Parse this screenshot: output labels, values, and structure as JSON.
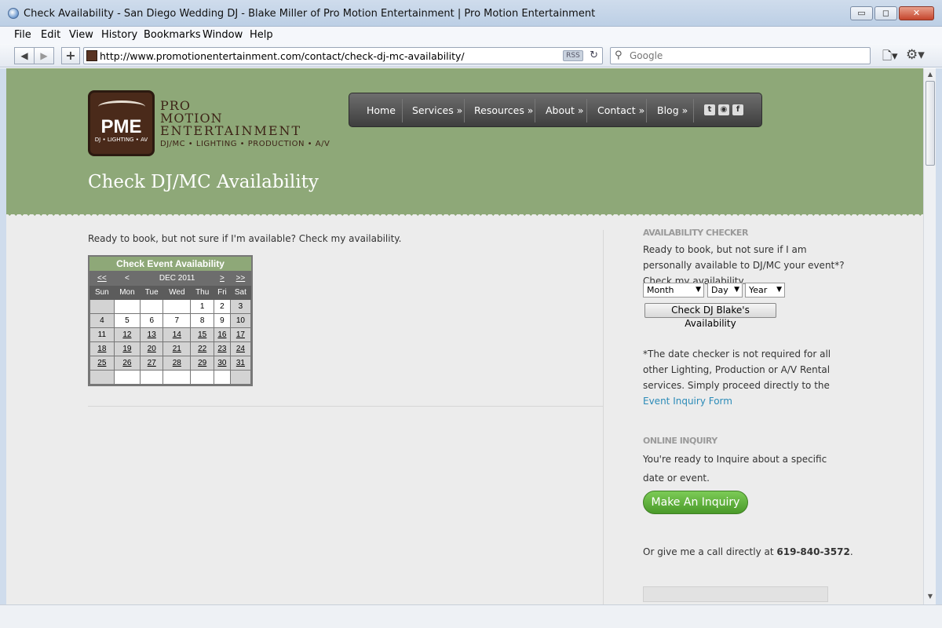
{
  "window": {
    "title": "Check Availability - San Diego Wedding DJ - Blake Miller of Pro Motion Entertainment | Pro Motion Entertainment",
    "minimize": "▭",
    "maximize": "◻",
    "close": "✕"
  },
  "menu": [
    "File",
    "Edit",
    "View",
    "History",
    "Bookmarks",
    "Window",
    "Help"
  ],
  "toolbar": {
    "back": "◀",
    "forward": "▶",
    "add": "+",
    "url": "http://www.promotionentertainment.com/contact/check-dj-mc-availability/",
    "rss": "RSS",
    "reload": "↻",
    "search_placeholder": "Google"
  },
  "site": {
    "logo": {
      "badge": "PME",
      "tag": "DJ • LIGHTING • AV",
      "line1": "PRO",
      "line2": "MOTION",
      "line3": "ENTERTAINMENT",
      "line4": "DJ/MC • LIGHTING • PRODUCTION • A/V"
    },
    "nav": [
      "Home",
      "Services »",
      "Resources »",
      "About »",
      "Contact »",
      "Blog »"
    ],
    "social": {
      "twitter": "t",
      "rss": "◉",
      "facebook": "f"
    },
    "page_title": "Check DJ/MC Availability"
  },
  "main": {
    "intro": "Ready to book, but not sure if I'm available? Check my availability.",
    "calendar": {
      "title": "Check Event Availability",
      "nav": {
        "prev_year": "<<",
        "prev_month": "<",
        "month": "DEC 2011",
        "next_month": ">",
        "next_year": ">>"
      },
      "weekdays": [
        "Sun",
        "Mon",
        "Tue",
        "Wed",
        "Thu",
        "Fri",
        "Sat"
      ],
      "weeks": [
        [
          "",
          "",
          "",
          "",
          "1",
          "2",
          "3"
        ],
        [
          "4",
          "5",
          "6",
          "7",
          "8",
          "9",
          "10"
        ],
        [
          "11",
          "12",
          "13",
          "14",
          "15",
          "16",
          "17"
        ],
        [
          "18",
          "19",
          "20",
          "21",
          "22",
          "23",
          "24"
        ],
        [
          "25",
          "26",
          "27",
          "28",
          "29",
          "30",
          "31"
        ],
        [
          "",
          "",
          "",
          "",
          "",
          "",
          ""
        ]
      ]
    }
  },
  "sidebar": {
    "checker_heading": "AVAILABILITY CHECKER",
    "checker_text": [
      "Ready to book, but not sure if I am",
      "personally available to DJ/MC your event*?",
      "Check my availability."
    ],
    "month": "Month",
    "day": "Day",
    "year": "Year",
    "check_button": "Check DJ Blake's Availability",
    "note": [
      "*The date checker is not required for all",
      "other Lighting, Production or A/V Rental",
      "services. Simply proceed directly to the"
    ],
    "note_link": "Event Inquiry Form",
    "inquiry_heading": "ONLINE INQUIRY",
    "inquiry_text": [
      "You're ready to Inquire about a specific",
      "date or event."
    ],
    "inquiry_button": "Make An Inquiry",
    "call_text": "Or give me a call directly at ",
    "phone": "619-840-3572",
    "phone_suffix": "."
  },
  "scrollbar": {
    "up": "▲",
    "down": "▼"
  }
}
